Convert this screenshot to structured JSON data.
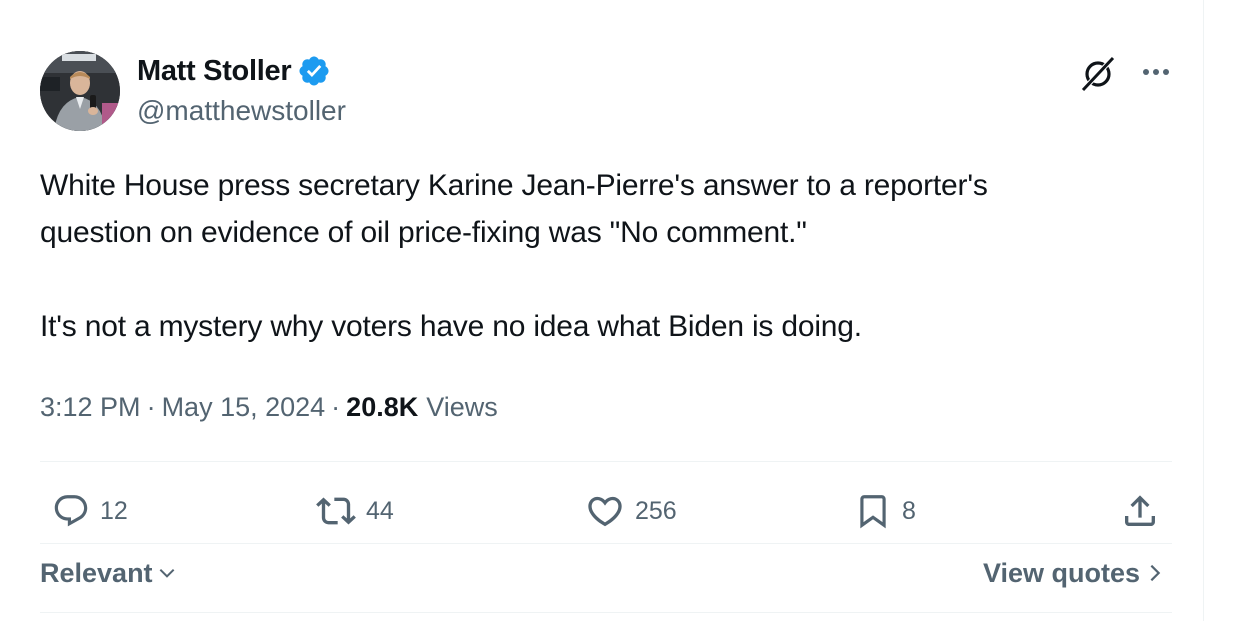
{
  "author": {
    "display_name": "Matt Stoller",
    "handle": "@matthewstoller",
    "verified_color": "#1d9bf0"
  },
  "header_icons": {
    "grok": "grok-icon",
    "more": "more-dots-icon"
  },
  "tweet": {
    "paragraphs": [
      "White House press secretary Karine Jean-Pierre's answer to a reporter's",
      "question on evidence of oil price-fixing was \"No comment.\"",
      "It's not a mystery why voters have no idea what Biden is doing."
    ],
    "time": "3:12 PM",
    "date": "May 15, 2024",
    "separator": "·",
    "views_count": "20.8K",
    "views_label": "Views"
  },
  "actions": {
    "replies": {
      "count": "12",
      "icon": "reply-icon"
    },
    "reposts": {
      "count": "44",
      "icon": "repost-icon"
    },
    "likes": {
      "count": "256",
      "icon": "heart-icon"
    },
    "bookmarks": {
      "count": "8",
      "icon": "bookmark-icon"
    },
    "share": {
      "icon": "share-icon"
    }
  },
  "footer": {
    "sort_label": "Relevant",
    "view_quotes_label": "View quotes"
  },
  "colors": {
    "text_primary": "#0f1419",
    "text_secondary": "#536471",
    "divider": "#eff3f4"
  }
}
